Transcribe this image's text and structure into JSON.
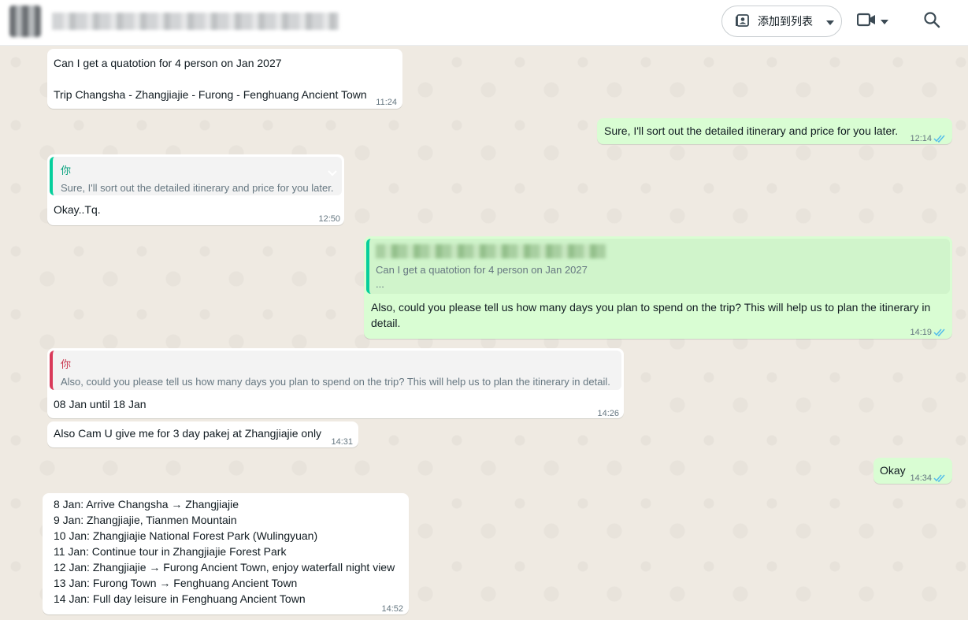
{
  "header": {
    "contact_name": "████████ ███ ████████",
    "add_to_list_label": "添加到列表"
  },
  "messages": {
    "m1": {
      "line1": "Can I get a quatotion for 4 person on Jan 2027",
      "line2": "Trip Changsha - Zhangjiajie - Furong - Fenghuang Ancient Town",
      "time": "11:24"
    },
    "m2": {
      "text": "Sure, I'll sort out the detailed itinerary and price for you later.",
      "time": "12:14"
    },
    "m3": {
      "quote_author": "你",
      "quote_text": "Sure, I'll sort out the detailed itinerary and price for you later.",
      "text": "Okay..Tq.",
      "time": "12:50"
    },
    "m4": {
      "quote_author": "██████ ███████",
      "quote_text": "Can I get a quatotion for 4 person on Jan 2027",
      "quote_more": "...",
      "line1": "Also, could you please tell us how many days you plan to spend on the trip? This will help us to plan the itinerary in",
      "line2": "detail.",
      "time": "14:19"
    },
    "m5": {
      "quote_author": "你",
      "quote_text": "Also, could you please tell us how many days you plan to spend on the trip? This will help us to plan the itinerary in detail.",
      "text": "08 Jan until 18 Jan",
      "time": "14:26"
    },
    "m6": {
      "text": "Also Cam U give me for 3 day pakej at Zhangjiajie only",
      "time": "14:31"
    },
    "m7": {
      "text": "Okay",
      "time": "14:34"
    },
    "m8": {
      "lines": [
        "8 Jan: Arrive Changsha → Zhangjiajie",
        "9 Jan: Zhangjiajie, Tianmen Mountain",
        "10 Jan: Zhangjiajie National Forest Park (Wulingyuan)",
        "11 Jan: Continue tour in Zhangjiajie Forest Park",
        "12 Jan: Zhangjiajie → Furong Ancient Town, enjoy waterfall night view",
        "13 Jan: Furong Town → Fenghuang Ancient Town",
        "14 Jan: Full day leisure in Fenghuang Ancient Town"
      ],
      "time": "14:52"
    }
  },
  "icons": {
    "read_ticks_color": "#53bdeb",
    "accent_green": "#06cf9c",
    "quote_red": "#d93a5a"
  }
}
